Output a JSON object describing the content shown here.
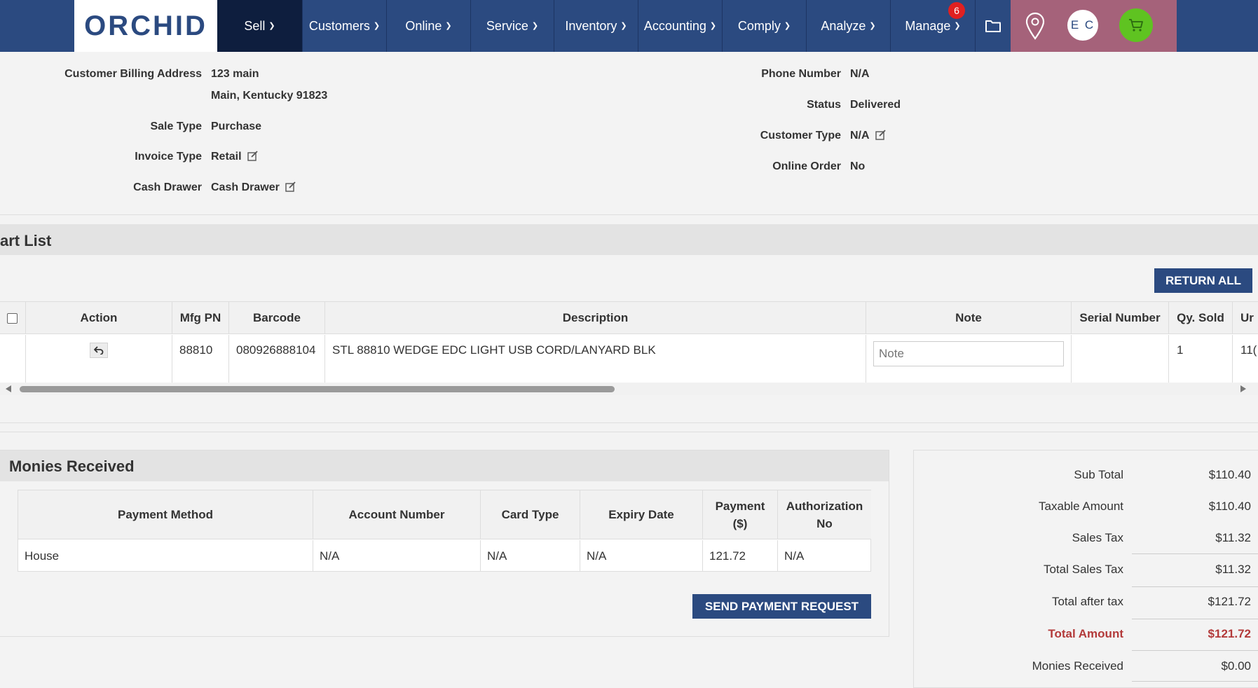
{
  "nav": {
    "logo": "ORCHID",
    "items": [
      {
        "label": "Sell"
      },
      {
        "label": "Customers"
      },
      {
        "label": "Online"
      },
      {
        "label": "Service"
      },
      {
        "label": "Inventory"
      },
      {
        "label": "Accounting"
      },
      {
        "label": "Comply"
      },
      {
        "label": "Analyze"
      },
      {
        "label": "Manage",
        "badge": "6"
      }
    ],
    "avatar_initials": "E C",
    "icons": [
      "folder-icon",
      "location-pin-icon",
      "cart-icon"
    ],
    "colors": {
      "navbar": "#2b4a80",
      "active": "#0e1e3e",
      "right_panel": "#a5627a",
      "cart": "#5fc321",
      "badge": "#e02020"
    }
  },
  "invoice_info": {
    "billing_label": "Customer Billing Address",
    "billing_line1": "123 main",
    "billing_line2": "Main, Kentucky 91823",
    "sale_type_label": "Sale Type",
    "sale_type": "Purchase",
    "invoice_type_label": "Invoice Type",
    "invoice_type": "Retail",
    "cash_drawer_label": "Cash Drawer",
    "cash_drawer": "Cash Drawer",
    "phone_label": "Phone Number",
    "phone": "N/A",
    "status_label": "Status",
    "status": "Delivered",
    "customer_type_label": "Customer Type",
    "customer_type": "N/A",
    "online_order_label": "Online Order",
    "online_order": "No"
  },
  "cart": {
    "title": "art List",
    "return_all": "RETURN ALL",
    "headers": {
      "action": "Action",
      "mfg_pn": "Mfg PN",
      "barcode": "Barcode",
      "description": "Description",
      "note": "Note",
      "serial": "Serial Number",
      "qty_sold": "Qy. Sold",
      "unit": "Ur"
    },
    "rows": [
      {
        "mfg_pn": "88810",
        "barcode": "080926888104",
        "description": "STL 88810 WEDGE EDC LIGHT USB CORD/LANYARD BLK",
        "note_placeholder": "Note",
        "serial": "",
        "qty_sold": "1",
        "unit": "11("
      }
    ]
  },
  "monies": {
    "title": "Monies Received",
    "headers": {
      "method": "Payment Method",
      "account": "Account Number",
      "card_type": "Card Type",
      "expiry": "Expiry Date",
      "payment_line1": "Payment",
      "payment_line2": "($)",
      "auth_line1": "Authorization",
      "auth_line2": "No"
    },
    "rows": [
      {
        "method": "House",
        "account": "N/A",
        "card_type": "N/A",
        "expiry": "N/A",
        "payment": "121.72",
        "auth": "N/A"
      }
    ],
    "send_button": "SEND PAYMENT REQUEST"
  },
  "totals": {
    "sub_total_label": "Sub Total",
    "sub_total": "$110.40",
    "taxable_label": "Taxable Amount",
    "taxable": "$110.40",
    "sales_tax_label": "Sales Tax",
    "sales_tax": "$11.32",
    "total_sales_tax_label": "Total Sales Tax",
    "total_sales_tax": "$11.32",
    "after_tax_label": "Total after tax",
    "after_tax": "$121.72",
    "total_amount_label": "Total Amount",
    "total_amount": "$121.72",
    "monies_received_label": "Monies Received",
    "monies_received": "$0.00",
    "colors": {
      "total_amount": "#b33a3a"
    }
  }
}
